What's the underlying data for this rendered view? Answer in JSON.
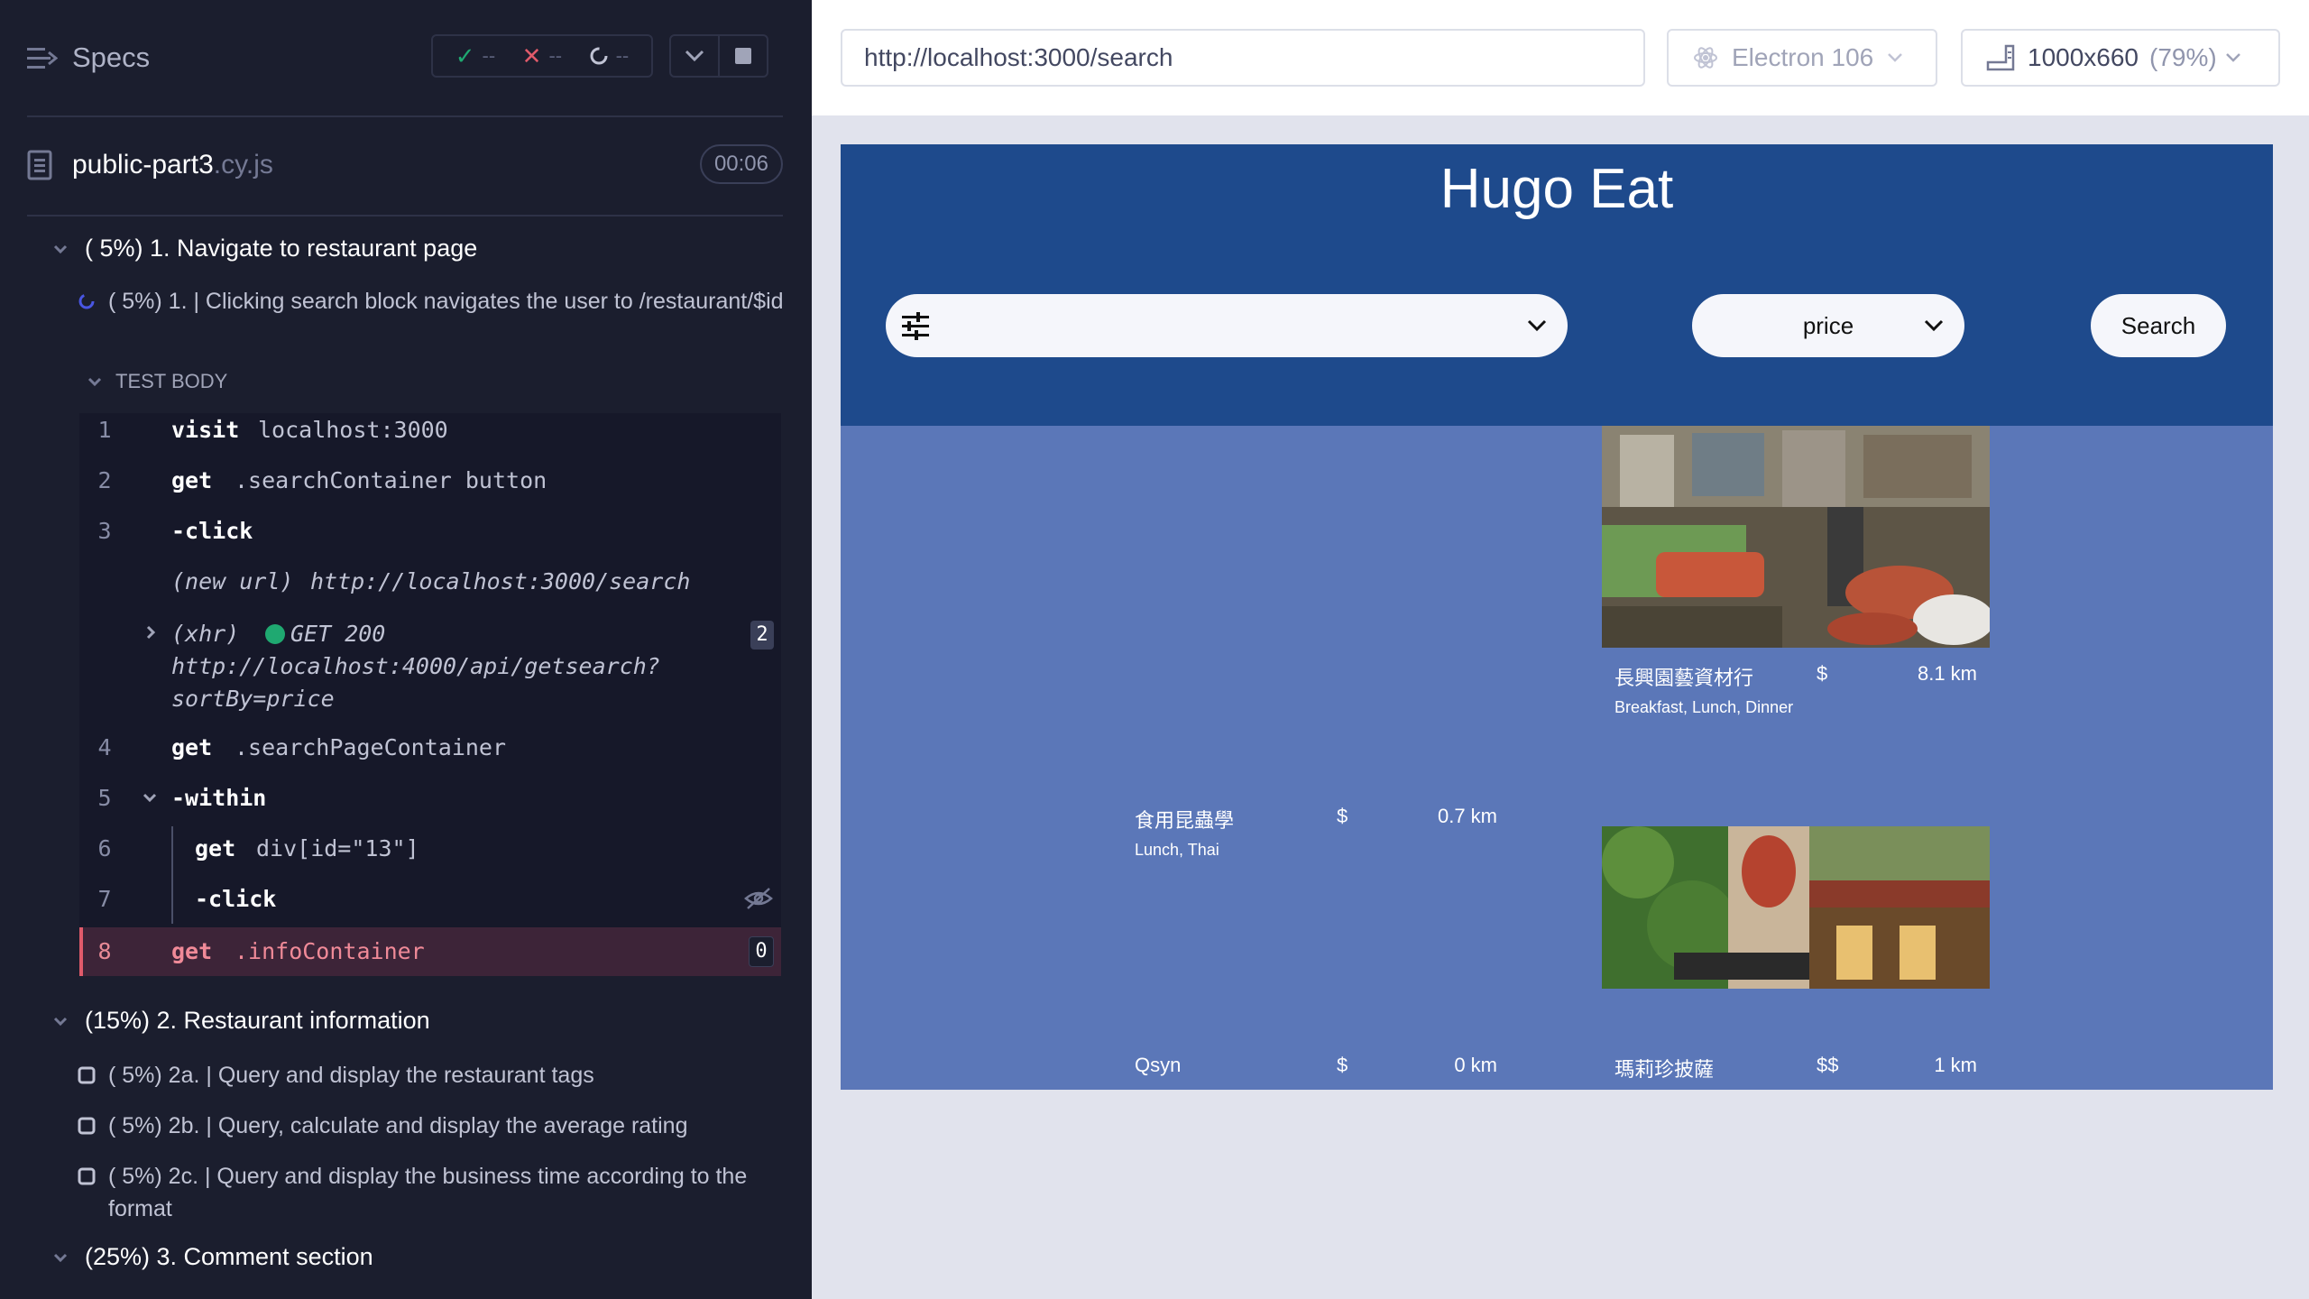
{
  "reporter": {
    "title": "Specs",
    "stats": {
      "passed": "--",
      "failed": "--",
      "pending": "--"
    },
    "spec_file": {
      "name": "public-part3",
      "ext": ".cy.js",
      "duration": "00:06"
    },
    "suite1": {
      "label": "( 5%) 1. Navigate to restaurant page",
      "test": "( 5%) 1. | Clicking search block navigates the user to /restaurant/$id",
      "body_label": "TEST BODY",
      "commands": [
        {
          "num": "1",
          "name": "visit",
          "msg": "localhost:3000"
        },
        {
          "num": "2",
          "name": "get",
          "msg": ".searchContainer button"
        },
        {
          "num": "3",
          "name": "-click",
          "msg": ""
        },
        {
          "num": "",
          "name": "(new url)",
          "msg": "http://localhost:3000/search"
        },
        {
          "num": "",
          "name": "(xhr)",
          "msg": "GET 200",
          "url": "http://localhost:4000/api/getsearch?",
          "url2": "sortBy=price",
          "badge": "2"
        },
        {
          "num": "4",
          "name": "get",
          "msg": ".searchPageContainer"
        },
        {
          "num": "5",
          "name": "-within",
          "msg": ""
        },
        {
          "num": "6",
          "name": "get",
          "msg": "div[id=\"13\"]"
        },
        {
          "num": "7",
          "name": "-click",
          "msg": ""
        },
        {
          "num": "8",
          "name": "get",
          "msg": ".infoContainer",
          "badge": "0"
        }
      ]
    },
    "suite2": {
      "label": "(15%) 2. Restaurant information",
      "tests": [
        "( 5%) 2a. | Query and display the restaurant tags",
        "( 5%) 2b. | Query, calculate and display the average rating",
        "( 5%) 2c. | Query and display the business time according to the format"
      ]
    },
    "suite3": {
      "label": "(25%) 3. Comment section"
    }
  },
  "browser": {
    "url": "http://localhost:3000/search",
    "browser_name": "Electron 106",
    "viewport": "1000x660",
    "scale": "(79%)"
  },
  "app": {
    "title": "Hugo Eat",
    "sort_value": "price",
    "search_label": "Search",
    "results": [
      {
        "name": "食用昆蟲學",
        "price": "$",
        "distance": "0.7 km",
        "tags": "Lunch, Thai"
      },
      {
        "name": "長興園藝資材行",
        "price": "$",
        "distance": "8.1 km",
        "tags": "Breakfast, Lunch, Dinner"
      },
      {
        "name": "Qsyn",
        "price": "$",
        "distance": "0 km",
        "tags": ""
      },
      {
        "name": "瑪莉珍披薩",
        "price": "$$",
        "distance": "1 km",
        "tags": ""
      }
    ]
  },
  "colors": {
    "pass": "#1fa971",
    "fail": "#e05a6a",
    "app_header": "#1e4a8c",
    "app_body": "#5b77b8"
  }
}
